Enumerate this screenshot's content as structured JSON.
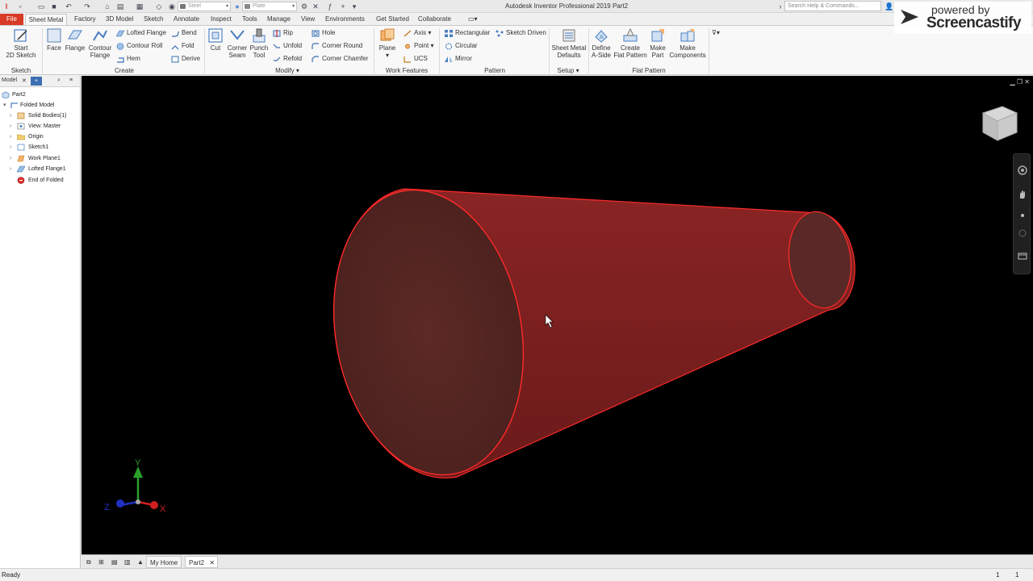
{
  "titlebar": {
    "title": "Autodesk Inventor Professional 2019   Part2",
    "material": "Steel",
    "appearance": "Plate",
    "search_placeholder": "Search Help & Commands..."
  },
  "watermark": {
    "small": "powered by",
    "big": "Screencastify"
  },
  "tabs": [
    "File",
    "Sheet Metal",
    "Factory",
    "3D Model",
    "Sketch",
    "Annotate",
    "Inspect",
    "Tools",
    "Manage",
    "View",
    "Environments",
    "Get Started",
    "Collaborate"
  ],
  "ribbon": {
    "sketch": {
      "start_sketch": [
        "Start",
        "2D Sketch"
      ],
      "label": "Sketch"
    },
    "create": {
      "face": "Face",
      "flange": "Flange",
      "contour_flange": [
        "Contour",
        "Flange"
      ],
      "lofted_flange": "Lofted Flange",
      "contour_roll": "Contour Roll",
      "hem": "Hem",
      "bend": "Bend",
      "fold": "Fold",
      "derive": "Derive",
      "label": "Create"
    },
    "modify": {
      "cut": "Cut",
      "corner_seam": [
        "Corner",
        "Seam"
      ],
      "punch_tool": [
        "Punch",
        "Tool"
      ],
      "rip": "Rip",
      "unfold": "Unfold",
      "refold": "Refold",
      "hole": "Hole",
      "corner_round": "Corner Round",
      "corner_chamfer": "Corner Chamfer",
      "label": "Modify"
    },
    "work_features": {
      "plane": "Plane",
      "axis": "Axis",
      "point": "Point",
      "ucs": "UCS",
      "label": "Work Features"
    },
    "pattern": {
      "rectangular": "Rectangular",
      "circular": "Circular",
      "mirror": "Mirror",
      "sketch_driven": "Sketch Driven",
      "label": "Pattern"
    },
    "setup": {
      "sheet_metal_defaults": [
        "Sheet Metal",
        "Defaults"
      ],
      "label": "Setup"
    },
    "flat_pattern": {
      "define_a_side": [
        "Define",
        "A-Side"
      ],
      "create_flat_pattern": [
        "Create",
        "Flat Pattern"
      ],
      "make_part": [
        "Make",
        "Part"
      ],
      "make_components": [
        "Make",
        "Components"
      ],
      "label": "Flat Pattern"
    }
  },
  "browser": {
    "tab": "Model",
    "items": [
      {
        "label": "Part2"
      },
      {
        "label": "Folded Model"
      },
      {
        "label": "Solid Bodies(1)"
      },
      {
        "label": "View: Master"
      },
      {
        "label": "Origin"
      },
      {
        "label": "Sketch1"
      },
      {
        "label": "Work Plane1"
      },
      {
        "label": "Lofted Flange1"
      },
      {
        "label": "End of Folded"
      }
    ]
  },
  "viewport": {
    "triad": {
      "x": "X",
      "y": "Y",
      "z": "Z"
    },
    "body_color": "#7a1f1f",
    "edge_color": "#ff2a2a"
  },
  "doctabs": {
    "home": "My Home",
    "part": "Part2"
  },
  "status": {
    "text": "Ready",
    "count1": "1",
    "count2": "1"
  }
}
